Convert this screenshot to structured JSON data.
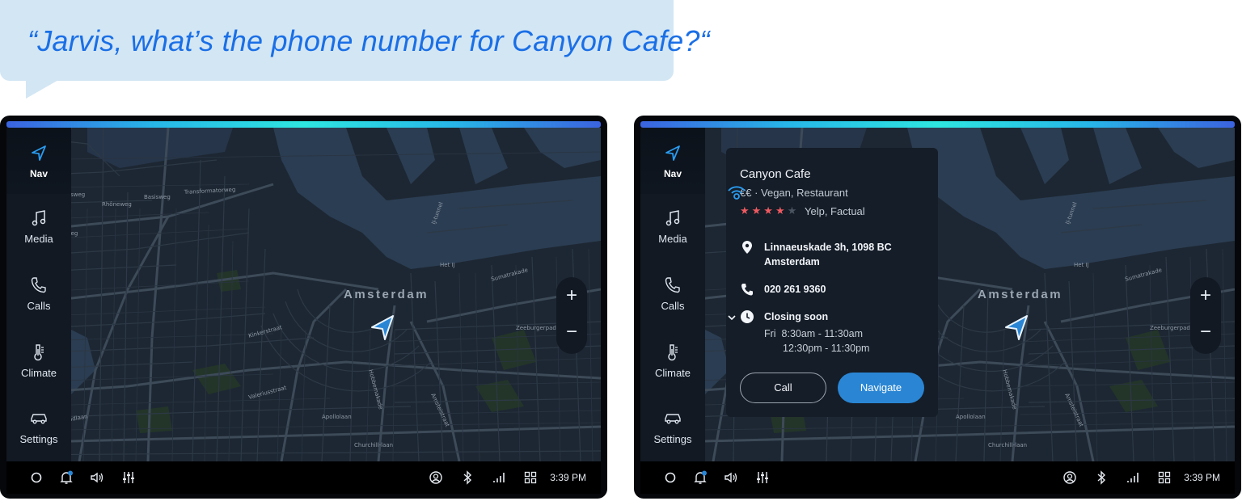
{
  "voice_query": "“Jarvis, what’s the phone number for Canyon Cafe?“",
  "sidebar": {
    "items": [
      {
        "label": "Nav",
        "icon": "navigation-arrow-icon",
        "active": true
      },
      {
        "label": "Media",
        "icon": "music-note-icon"
      },
      {
        "label": "Calls",
        "icon": "phone-icon"
      },
      {
        "label": "Climate",
        "icon": "thermometer-icon"
      },
      {
        "label": "Settings",
        "icon": "car-icon"
      }
    ]
  },
  "map": {
    "city_label": "Amsterdam",
    "zoom_in": "+",
    "zoom_out": "−",
    "streets": [
      "Transformatorweg",
      "Basisweg",
      "Rhôneweg",
      "Theemsweg",
      "Haarlemmerweg",
      "Radarweg",
      "Bosweg",
      "Kinkerstraat",
      "Valeriusstraat",
      "Apollolaan",
      "Churchill-laan",
      "Hobbemakade",
      "Amstelstraat",
      "Zeeburgerpad",
      "Pieter Calandlaan",
      "Sumatrakade",
      "IJ-tunnel",
      "Het IJ"
    ]
  },
  "status_bar": {
    "time": "3:39 PM",
    "icons": [
      "home-circle-icon",
      "notification-bell-icon",
      "volume-icon",
      "equalizer-icon",
      "user-profile-icon",
      "bluetooth-icon",
      "signal-bars-icon",
      "apps-grid-icon"
    ]
  },
  "poi_card": {
    "name": "Canyon Cafe",
    "category": "€€ · Vegan, Restaurant",
    "rating_stars": 4,
    "rating_max": 5,
    "rating_source": "Yelp, Factual",
    "address_line1": "Linnaeuskade 3h, 1098 BC",
    "address_line2": "Amsterdam",
    "phone": "020 261 9360",
    "hours_status": "Closing soon",
    "hours_day": "Fri",
    "hours_slot1": "8:30am - 11:30am",
    "hours_slot2": "12:30pm - 11:30pm",
    "call_label": "Call",
    "navigate_label": "Navigate"
  },
  "colors": {
    "bubble_bg": "#d3e6f4",
    "bubble_text": "#1a6fe6",
    "accent": "#2a86d4",
    "star": "#ef5a60",
    "glow_start": "#3b63e0",
    "glow_mid": "#2ee6e0"
  }
}
